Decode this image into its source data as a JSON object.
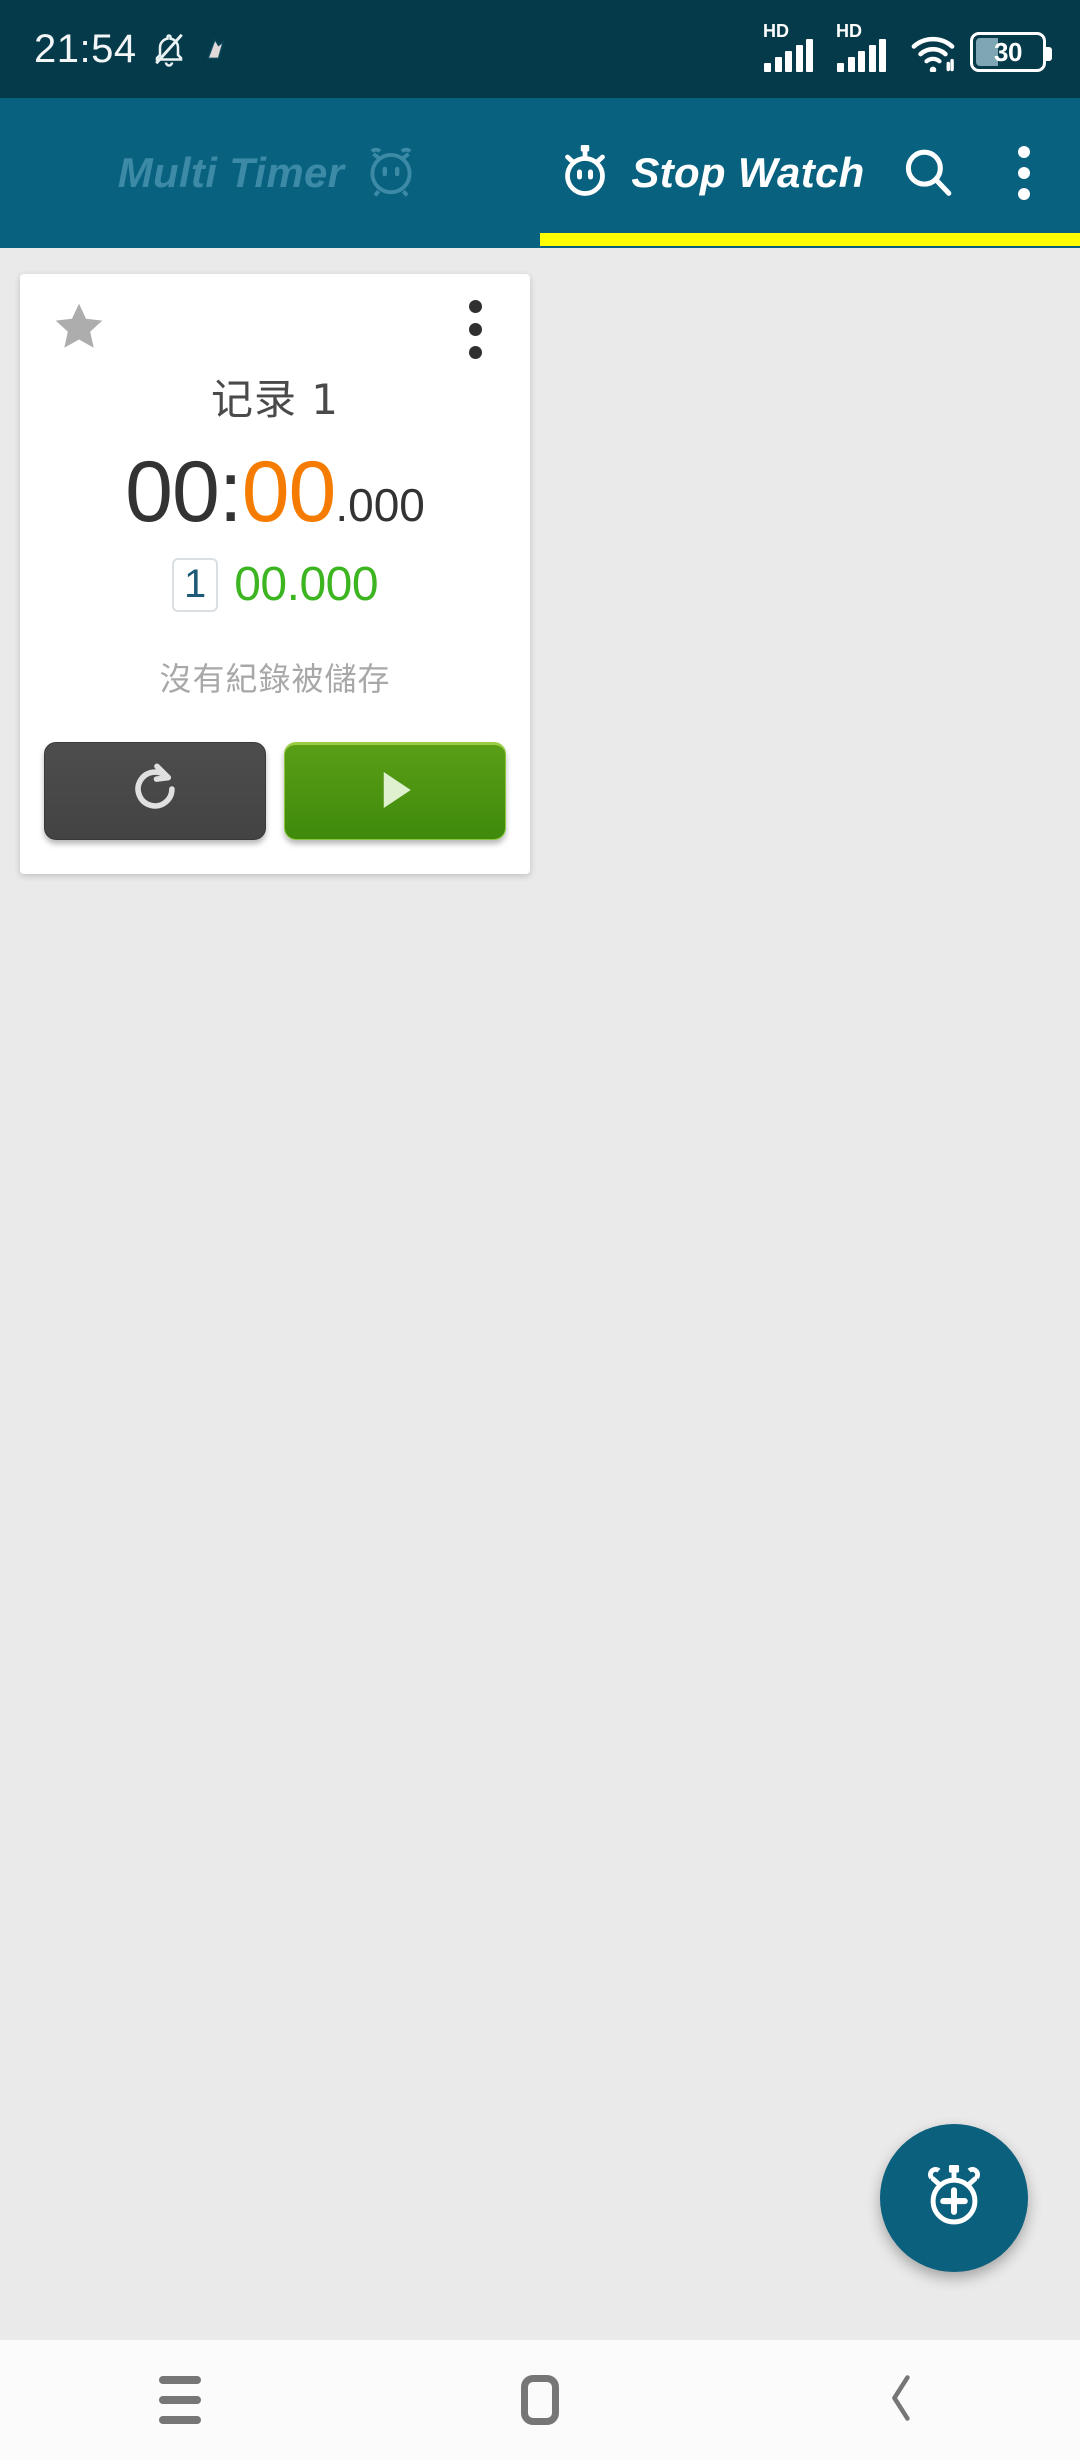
{
  "status_bar": {
    "time": "21:54",
    "icons": [
      "mute-bell-icon",
      "notification-icon",
      "signal-hd-icon",
      "signal-hd-icon",
      "wifi-icon",
      "battery-icon"
    ],
    "hd_label_1": "HD",
    "hd_label_2": "HD",
    "battery_level": "30",
    "background_color": "#053a4a"
  },
  "app_bar": {
    "background_color": "#07617f",
    "indicator_color": "#ffff00",
    "tabs": [
      {
        "label": "Multi Timer",
        "icon": "alarm-clock-icon",
        "active": false
      },
      {
        "label": "Stop Watch",
        "icon": "stopwatch-icon",
        "active": true
      }
    ],
    "actions": [
      {
        "name": "search-icon",
        "label": "Search"
      },
      {
        "name": "overflow-menu-icon",
        "label": "More options"
      }
    ]
  },
  "stopwatch_card": {
    "favorite_icon": "star-icon",
    "overflow_icon": "overflow-menu-icon",
    "title": "记录 1",
    "time": {
      "minutes": "00",
      "colon": ":",
      "seconds": "00",
      "milliseconds": ".000",
      "seconds_color": "#f57c00",
      "primary_color": "#333333"
    },
    "lap": {
      "number": "1",
      "time": "00.000",
      "time_color": "#3cb521",
      "number_color": "#1d5a78"
    },
    "empty_message": "沒有紀錄被儲存",
    "buttons": [
      {
        "name": "reset-button",
        "icon": "refresh-icon",
        "color": "#474747"
      },
      {
        "name": "start-button",
        "icon": "play-icon",
        "color": "#4a9112"
      }
    ]
  },
  "fab": {
    "name": "add-stopwatch-fab",
    "icon": "stopwatch-plus-icon",
    "color": "#0b607e"
  },
  "nav_bar": {
    "buttons": [
      {
        "name": "recents-button",
        "icon": "menu-icon"
      },
      {
        "name": "home-button",
        "icon": "home-square-icon"
      },
      {
        "name": "back-button",
        "icon": "chevron-left-icon"
      }
    ]
  }
}
